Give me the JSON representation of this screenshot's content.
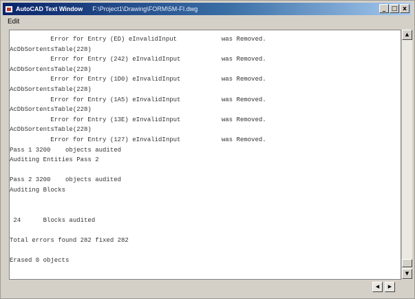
{
  "window": {
    "title": "AutoCAD Text Window",
    "path": "F:\\Project1\\Drawing\\FORM\\5M-FI.dwg",
    "minimize_glyph": "_",
    "maximize_glyph": "□",
    "close_glyph": "x"
  },
  "menu": {
    "edit_label": "Edit"
  },
  "console": {
    "lines": [
      "           Error for Entry (ED) eInvalidInput            was Removed.",
      "AcDbSortentsTable(228)",
      "           Error for Entry (242) eInvalidInput           was Removed.",
      "AcDbSortentsTable(228)",
      "           Error for Entry (1D0) eInvalidInput           was Removed.",
      "AcDbSortentsTable(228)",
      "           Error for Entry (1A5) eInvalidInput           was Removed.",
      "AcDbSortentsTable(228)",
      "           Error for Entry (13E) eInvalidInput           was Removed.",
      "AcDbSortentsTable(228)",
      "           Error for Entry (127) eInvalidInput           was Removed.",
      "Pass 1 3200    objects audited",
      "Auditing Entities Pass 2",
      "",
      "Pass 2 3200    objects audited",
      "Auditing Blocks",
      "",
      "",
      " 24      Blocks audited",
      "",
      "Total errors found 282 fixed 282",
      "",
      "Erased 0 objects"
    ]
  },
  "icons": {
    "app": "autocad-app-icon",
    "scroll_up": "scroll-up-arrow-icon",
    "scroll_down": "scroll-down-arrow-icon",
    "scroll_left": "scroll-left-arrow-icon",
    "scroll_right": "scroll-right-arrow-icon"
  },
  "glyphs": {
    "up": "▲",
    "down": "▼",
    "left": "◀",
    "right": "▶"
  }
}
